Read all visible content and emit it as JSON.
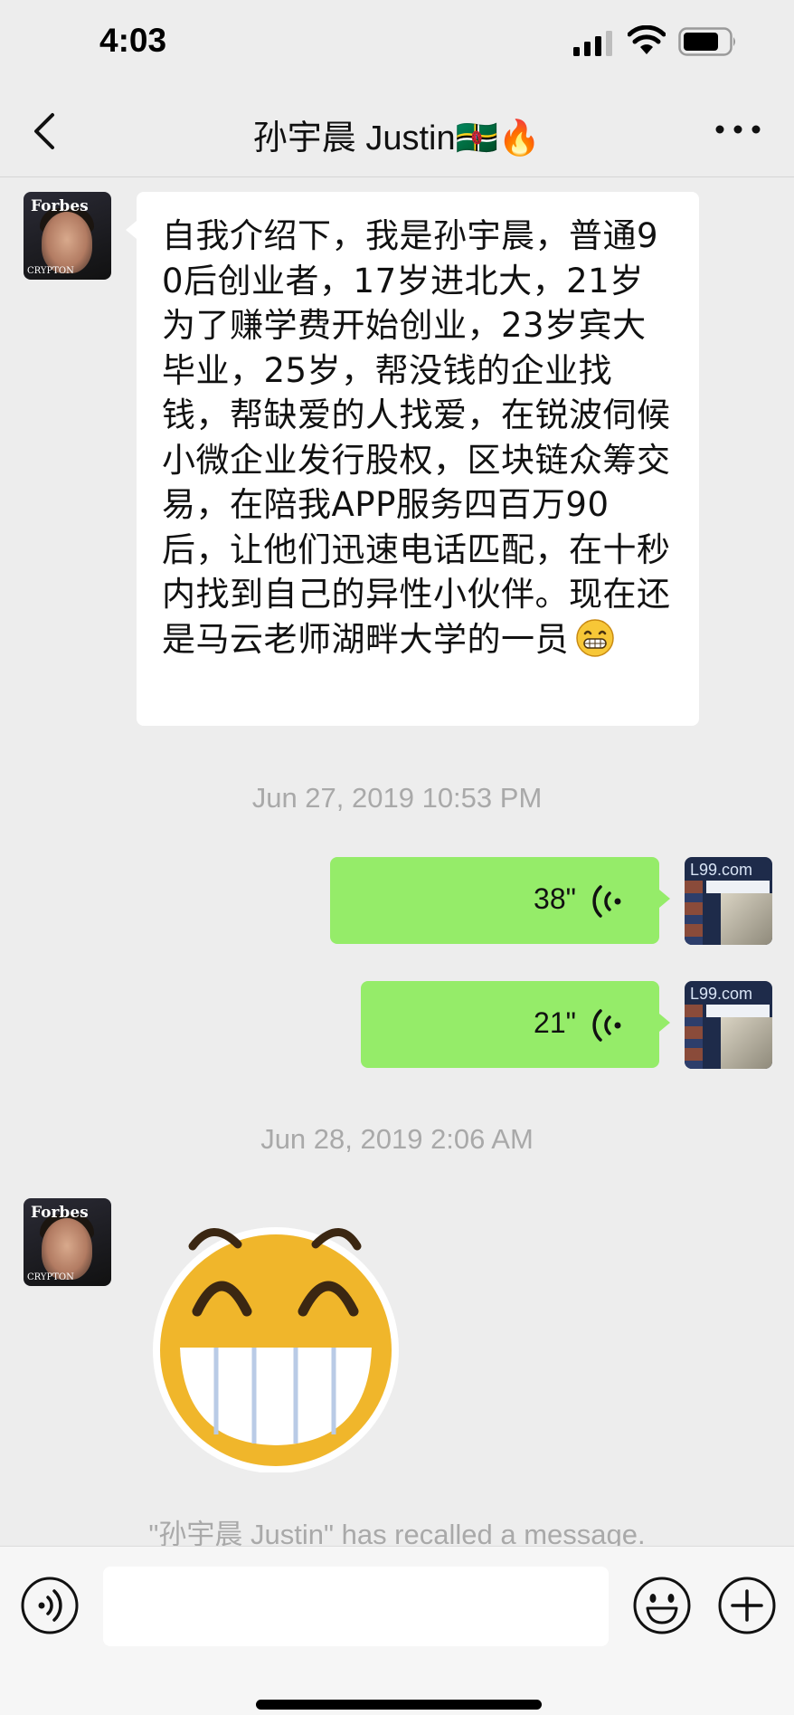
{
  "status_bar": {
    "time": "4:03",
    "signal_icon": "cellular-signal-icon",
    "wifi_icon": "wifi-icon",
    "battery_icon": "battery-icon"
  },
  "nav": {
    "back_icon": "chevron-left-icon",
    "title": "孙宇晨 Justin🇩🇲🔥",
    "more_icon": "more-dots-icon"
  },
  "messages": [
    {
      "type": "text",
      "direction": "incoming",
      "avatar": "contact-avatar",
      "avatar_text": "Forbes",
      "avatar_subtext": "CRYPTON",
      "text": "自我介绍下，我是孙宇晨，普通90后创业者，17岁进北大，21岁为了赚学费开始创业，23岁宾大毕业，25岁，帮没钱的企业找钱，帮缺爱的人找爱，在锐波伺候小微企业发行股权，区块链众筹交易，在陪我APP服务四百万90后，让他们迅速电话匹配，在十秒内找到自己的异性小伙伴。现在还是马云老师湖畔大学的一员",
      "trailing_emoji": "grin-emoji"
    },
    {
      "type": "timestamp",
      "text": "Jun 27, 2019 10:53 PM"
    },
    {
      "type": "voice",
      "direction": "outgoing",
      "duration": "38\""
    },
    {
      "type": "voice",
      "direction": "outgoing",
      "duration": "21\""
    },
    {
      "type": "timestamp",
      "text": "Jun 28, 2019 2:06 AM"
    },
    {
      "type": "sticker",
      "direction": "incoming",
      "sticker": "big-grin-sticker"
    },
    {
      "type": "system",
      "text": "\"孙宇晨 Justin\" has recalled a message."
    }
  ],
  "self_avatar": {
    "logo_text": "L99.com"
  },
  "input_bar": {
    "voice_toggle_icon": "voice-input-icon",
    "input_value": "",
    "emoji_icon": "emoji-icon",
    "plus_icon": "plus-icon"
  },
  "colors": {
    "background": "#ededed",
    "incoming_bubble": "#ffffff",
    "outgoing_bubble": "#95ec69",
    "timestamp_text": "#a9a9a9",
    "sticker_face": "#f0b62b"
  }
}
